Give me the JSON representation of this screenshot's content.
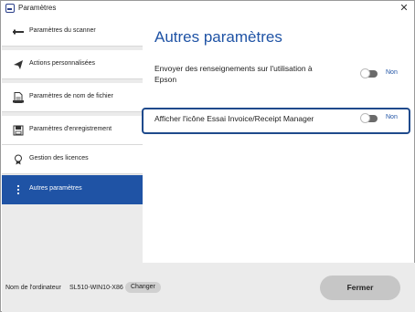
{
  "window": {
    "title": "Paramètres",
    "close_symbol": "✕"
  },
  "sidebar": {
    "items": [
      {
        "label": "Paramètres du scanner",
        "icon": "scanner-icon",
        "active": false
      },
      {
        "label": "Actions personnalisées",
        "icon": "send-icon",
        "active": false
      },
      {
        "label": "Paramètres de nom de fichier",
        "icon": "document-icon",
        "active": false
      },
      {
        "label": "Paramètres d'enregistrement",
        "icon": "save-icon",
        "active": false
      },
      {
        "label": "Gestion des licences",
        "icon": "license-icon",
        "active": false
      },
      {
        "label": "Autres paramètres",
        "icon": "more-icon",
        "active": true
      }
    ]
  },
  "main": {
    "title": "Autres paramètres",
    "settings": [
      {
        "label_line1": "Envoyer des renseignements sur l'utilisation à",
        "label_line2": "Epson",
        "state": "Non"
      },
      {
        "label_line1": "Afficher l'icône Essai Invoice/Receipt Manager",
        "state": "Non"
      }
    ]
  },
  "footer": {
    "computer_label": "Nom de l'ordinateur",
    "computer_value": "SL510-WIN10-X86",
    "change_label": "Changer",
    "close_label": "Fermer"
  },
  "colors": {
    "accent": "#1f53a5",
    "highlight": "#1f4a8c"
  }
}
